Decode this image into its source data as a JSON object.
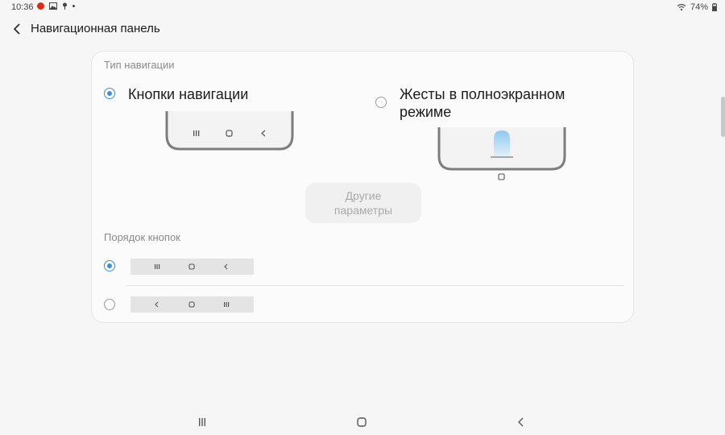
{
  "status_bar": {
    "time": "10:36",
    "battery": "74%",
    "icons_left": [
      "tomato-icon",
      "image-icon",
      "pin-icon",
      "dot-icon"
    ],
    "icons_right": [
      "wifi-icon",
      "battery-icon"
    ]
  },
  "header": {
    "title": "Навигационная панель",
    "back_icon": "chevron-left-icon"
  },
  "nav_type": {
    "heading": "Тип навигации",
    "options": [
      {
        "label": "Кнопки навигации",
        "selected": true
      },
      {
        "label_line1": "Жесты в полноэкранном",
        "label_line2": "режиме",
        "selected": false
      }
    ]
  },
  "other_params": {
    "line1": "Другие",
    "line2": "параметры",
    "enabled": false
  },
  "button_order": {
    "heading": "Порядок кнопок",
    "options": [
      {
        "keys": [
          "recents",
          "home",
          "back"
        ],
        "selected": true
      },
      {
        "keys": [
          "back",
          "home",
          "recents"
        ],
        "selected": false
      }
    ]
  },
  "accent_color": "#3f8ed6",
  "system_nav": [
    "recents-icon",
    "home-icon",
    "back-icon"
  ]
}
